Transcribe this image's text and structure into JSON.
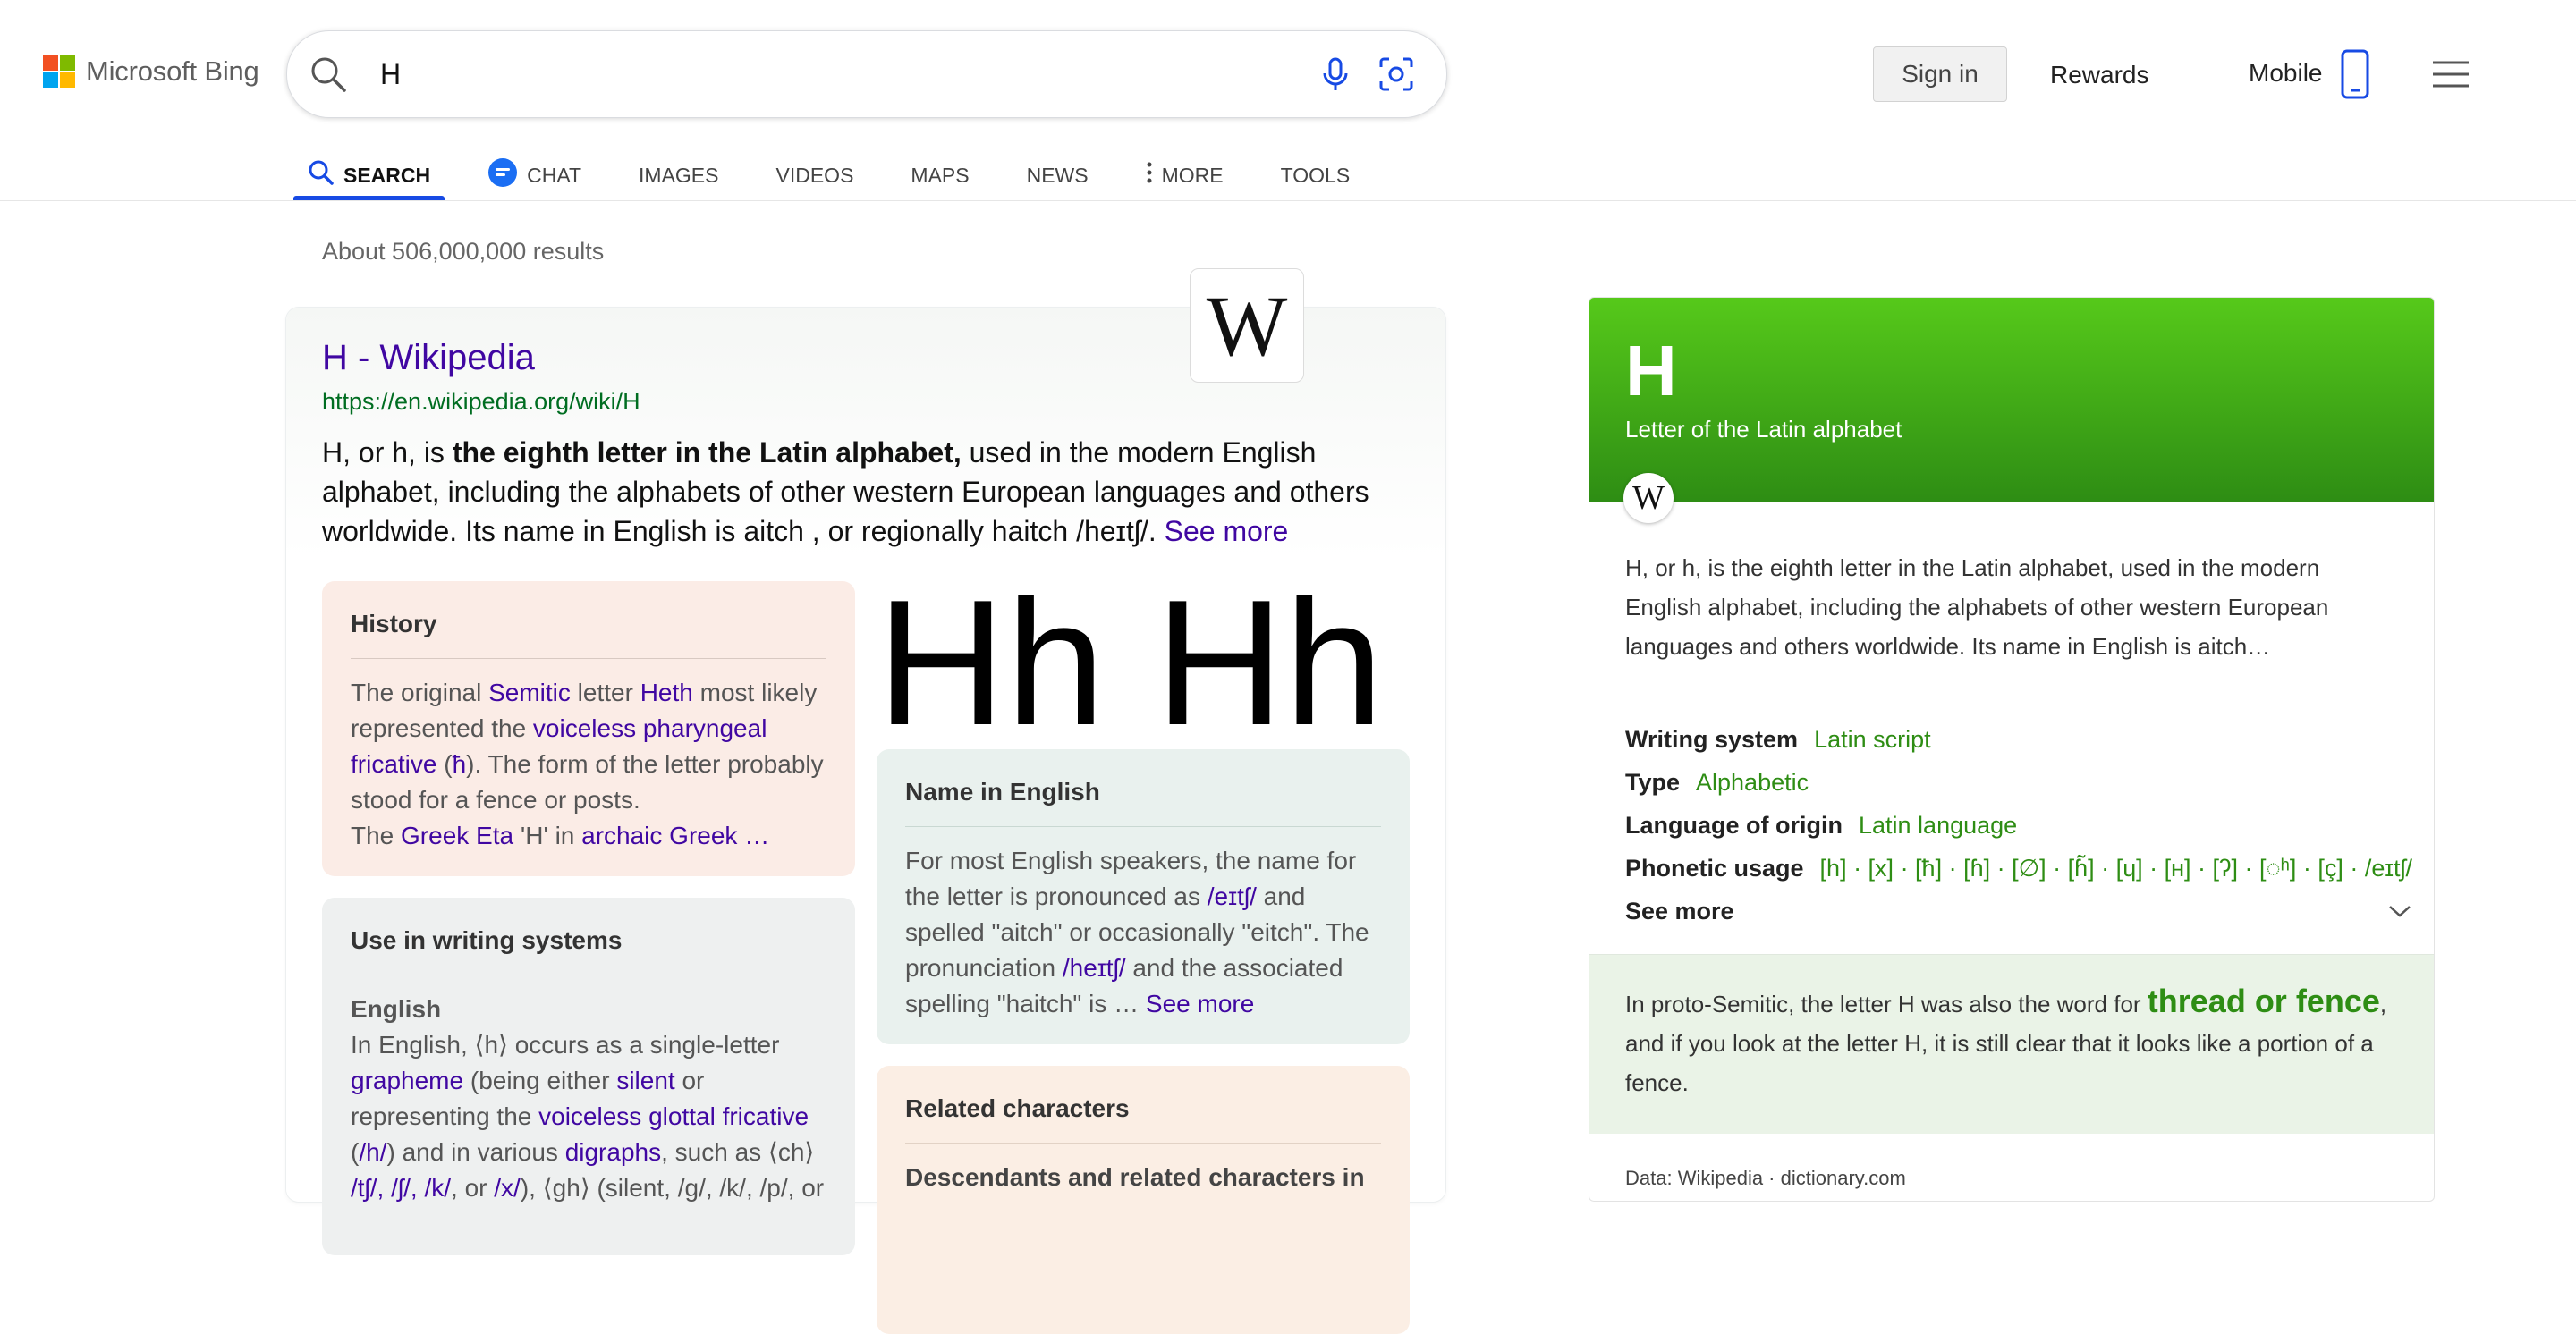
{
  "header": {
    "logo_text": "Microsoft Bing",
    "query": "H",
    "sign_in": "Sign in",
    "rewards": "Rewards",
    "mobile": "Mobile"
  },
  "tabs": [
    {
      "label": "SEARCH",
      "icon": "search-icon"
    },
    {
      "label": "CHAT",
      "icon": "chat-icon"
    },
    {
      "label": "IMAGES"
    },
    {
      "label": "VIDEOS"
    },
    {
      "label": "MAPS"
    },
    {
      "label": "NEWS"
    },
    {
      "label": "MORE",
      "icon": "more-vertical-icon"
    },
    {
      "label": "TOOLS"
    }
  ],
  "results_count": "About 506,000,000 results",
  "result": {
    "title": "H - Wikipedia",
    "url": "https://en.wikipedia.org/wiki/H",
    "snippet_pre": "H, or h, is ",
    "snippet_bold": "the eighth letter in the Latin alphabet,",
    "snippet_post": " used in the modern English alphabet, including the alphabets of other western European languages and others worldwide. Its name in English is aitch , or regionally haitch /heɪtʃ/. ",
    "see_more": "See more",
    "wiki_logo": "W",
    "image_text": "Hh Hh"
  },
  "history": {
    "title": "History",
    "t1": "The original ",
    "l1": "Semitic",
    "t2": " letter ",
    "l2": "Heth",
    "t3": " most likely represented the ",
    "l3": "voiceless pharyngeal fricative",
    "t4": " (",
    "l4": "ħ",
    "t5": "). The form of the letter probably stood for a fence or posts.",
    "t6": "The ",
    "l5": "Greek Eta",
    "t7": " 'H' in ",
    "l6": "archaic Greek …"
  },
  "name_in_english": {
    "title": "Name in English",
    "t1": "For most English speakers, the name for the letter is pronounced as ",
    "l1": "/eɪtʃ/",
    "t2": " and spelled \"aitch\" or occasionally \"eitch\". The pronunciation ",
    "l2": "/heɪtʃ/",
    "t3": " and the associated spelling \"haitch\" is … ",
    "see_more": "See more"
  },
  "use_in_writing": {
    "title": "Use in writing systems",
    "subtitle": "English",
    "t1": "In English, ⟨h⟩ occurs as a single-letter ",
    "l1": "grapheme",
    "t2": " (being either ",
    "l2": "silent",
    "t3": " or representing the ",
    "l3": "voiceless glottal fricative",
    "t4": " (",
    "l4": "/h/",
    "t5": ") and in various ",
    "l5": "digraphs",
    "t6": ", such as ⟨ch⟩ ",
    "l6": "/tʃ/, /ʃ/, /k/",
    "t7": ", or ",
    "l7": "/x/",
    "t8": "), ⟨gh⟩ (silent, /ɡ/, /k/, /p/, or"
  },
  "related": {
    "title": "Related characters",
    "subtitle": "Descendants and related characters in"
  },
  "side": {
    "title": "H",
    "subtitle": "Letter of the Latin alphabet",
    "wiki_logo": "W",
    "description": "H, or h, is the eighth letter in the Latin alphabet, used in the modern English alphabet, including the alphabets of other western European languages and others worldwide. Its name in English is aitch…",
    "facts": [
      {
        "key": "Writing system",
        "value": "Latin script"
      },
      {
        "key": "Type",
        "value": "Alphabetic"
      },
      {
        "key": "Language of origin",
        "value": "Latin language"
      },
      {
        "key": "Phonetic usage",
        "value": "[h] · [x] · [ħ] · [ɦ] · [∅] · [ɦ̃] · [ɥ] · [ʜ] · [ʔ] · [◌ʰ] · [ç] · /eɪtʃ/ · /…"
      }
    ],
    "see_more": "See more",
    "fun_fact_pre": "In proto-Semitic, the letter H was also the word for ",
    "fun_fact_highlight": "thread or fence",
    "fun_fact_post": ", and if you look at the letter H, it is still clear that it looks like a portion of a fence.",
    "footer": "Data: Wikipedia · dictionary.com"
  },
  "colors": {
    "accent": "#174ae4",
    "link": "#4007a2",
    "url": "#006d21",
    "green_panel": "#2e8d14"
  }
}
